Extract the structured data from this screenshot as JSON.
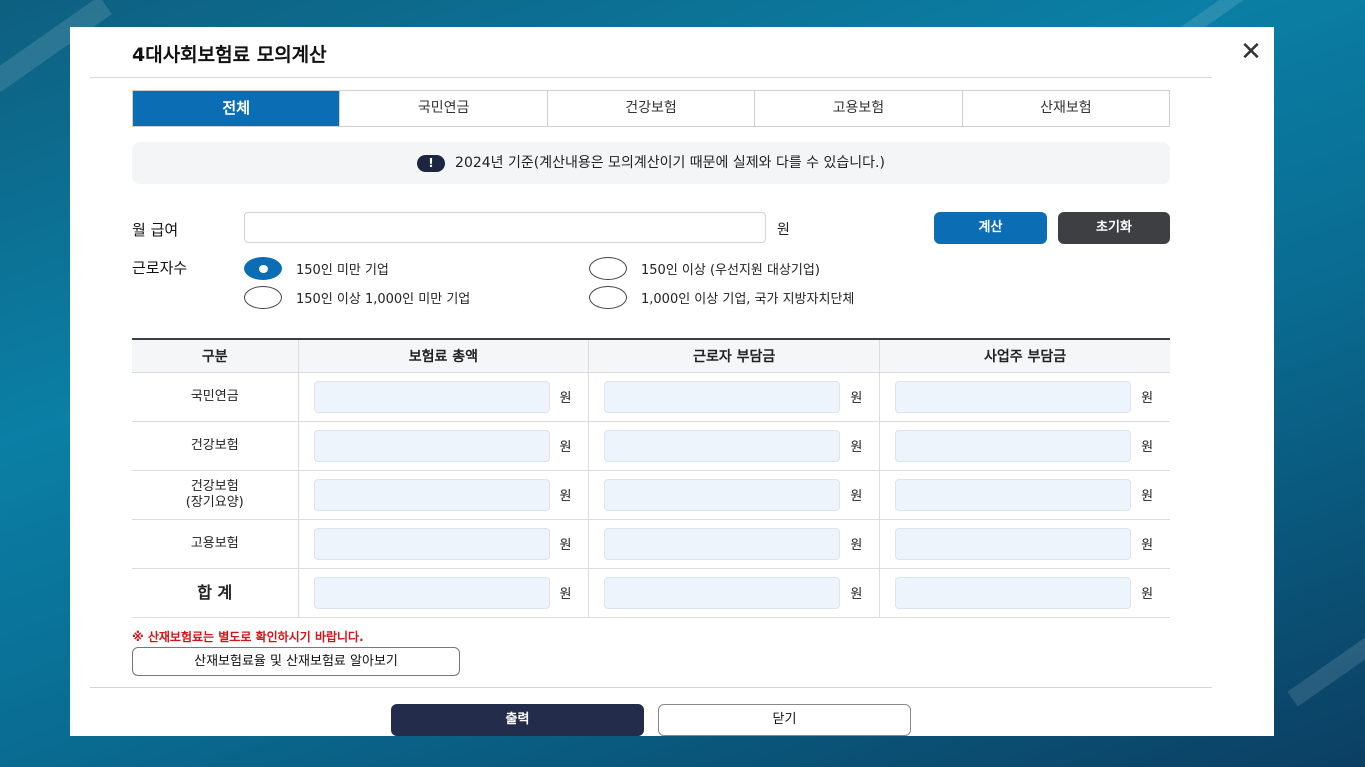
{
  "modal": {
    "title": "4대사회보험료 모의계산",
    "close_symbol": "✕"
  },
  "tabs": [
    {
      "label": "전체",
      "active": true
    },
    {
      "label": "국민연금",
      "active": false
    },
    {
      "label": "건강보험",
      "active": false
    },
    {
      "label": "고용보험",
      "active": false
    },
    {
      "label": "산재보험",
      "active": false
    }
  ],
  "notice": {
    "icon": "!",
    "text": "2024년 기준(계산내용은 모의계산이기 때문에 실제와 다를 수 있습니다.)"
  },
  "salary": {
    "label": "월 급여",
    "value": "",
    "unit": "원"
  },
  "buttons": {
    "calc": "계산",
    "reset": "초기화",
    "print": "출력",
    "close": "닫기"
  },
  "workers": {
    "label": "근로자수",
    "options": [
      {
        "label": "150인 미만 기업",
        "checked": true
      },
      {
        "label": "150인 이상 (우선지원 대상기업)",
        "checked": false
      },
      {
        "label": "150인 이상 1,000인 미만 기업",
        "checked": false
      },
      {
        "label": "1,000인 이상 기업, 국가 지방자치단체",
        "checked": false
      }
    ]
  },
  "table": {
    "headers": [
      "구분",
      "보험료 총액",
      "근로자 부담금",
      "사업주 부담금"
    ],
    "unit": "원",
    "rows": [
      {
        "label": "국민연금",
        "sub": ""
      },
      {
        "label": "건강보험",
        "sub": ""
      },
      {
        "label": "건강보험",
        "sub": "(장기요양)"
      },
      {
        "label": "고용보험",
        "sub": ""
      },
      {
        "label": "합 계",
        "sub": ""
      }
    ]
  },
  "warning": "※ 산재보험료는 별도로 확인하시기 바랍니다.",
  "link_button": "산재보험료율 및 산재보험료 알아보기",
  "colors": {
    "accent": "#0b6db3",
    "dark_button": "#3e3f43",
    "print_button": "#232c4a",
    "warning": "#d0161b"
  }
}
